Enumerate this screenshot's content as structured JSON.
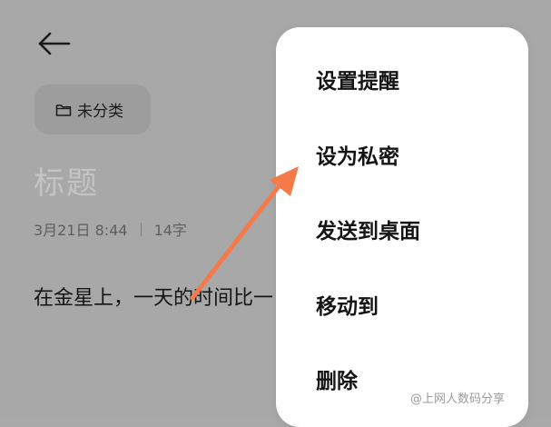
{
  "note": {
    "category_label": "未分类",
    "title_placeholder": "标题",
    "date": "3月21日 8:44",
    "word_count": "14字",
    "body_text": "在金星上，一天的时间比一"
  },
  "menu": {
    "items": [
      {
        "label": "设置提醒"
      },
      {
        "label": "设为私密"
      },
      {
        "label": "发送到桌面"
      },
      {
        "label": "移动到"
      },
      {
        "label": "删除"
      }
    ]
  },
  "watermark": "@上网人数码分享",
  "colors": {
    "background_dim": "#a8a8a8",
    "menu_bg": "#ffffff",
    "arrow": "#f47a4a"
  },
  "icons": {
    "back": "arrow-left-icon",
    "folder": "folder-icon"
  }
}
